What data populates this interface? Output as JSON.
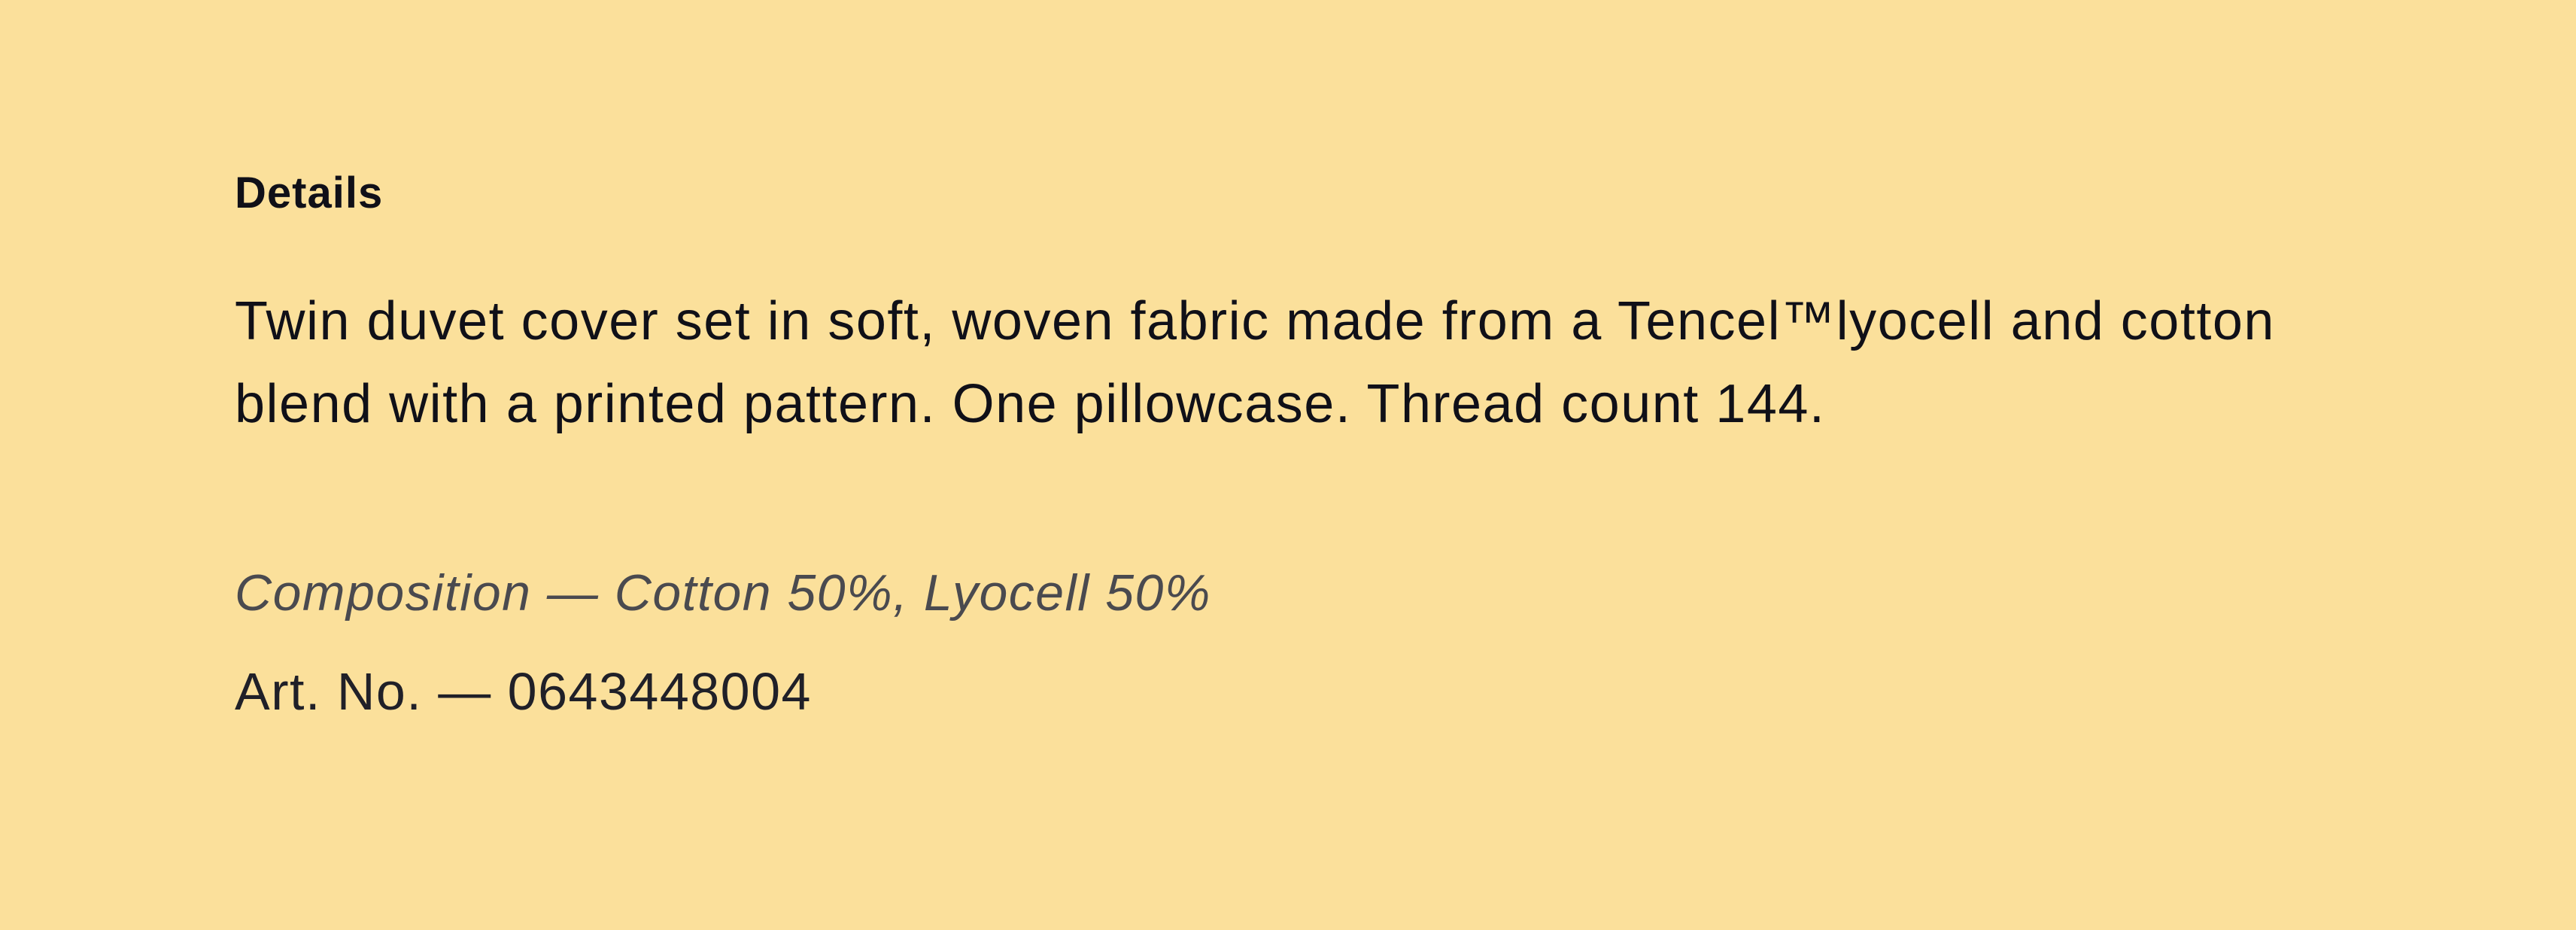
{
  "details": {
    "heading": "Details",
    "description": "Twin duvet cover set in soft, woven fabric made from a Tencel™lyocell and cotton blend with a printed pattern. One pillowcase. Thread count 144.",
    "composition": "Composition — Cotton 50%, Lyocell 50%",
    "article_number": "Art. No. — 0643448004"
  },
  "colors": {
    "background": "#fbe09b",
    "text": "#101018",
    "muted_text": "#4a4a4f"
  }
}
